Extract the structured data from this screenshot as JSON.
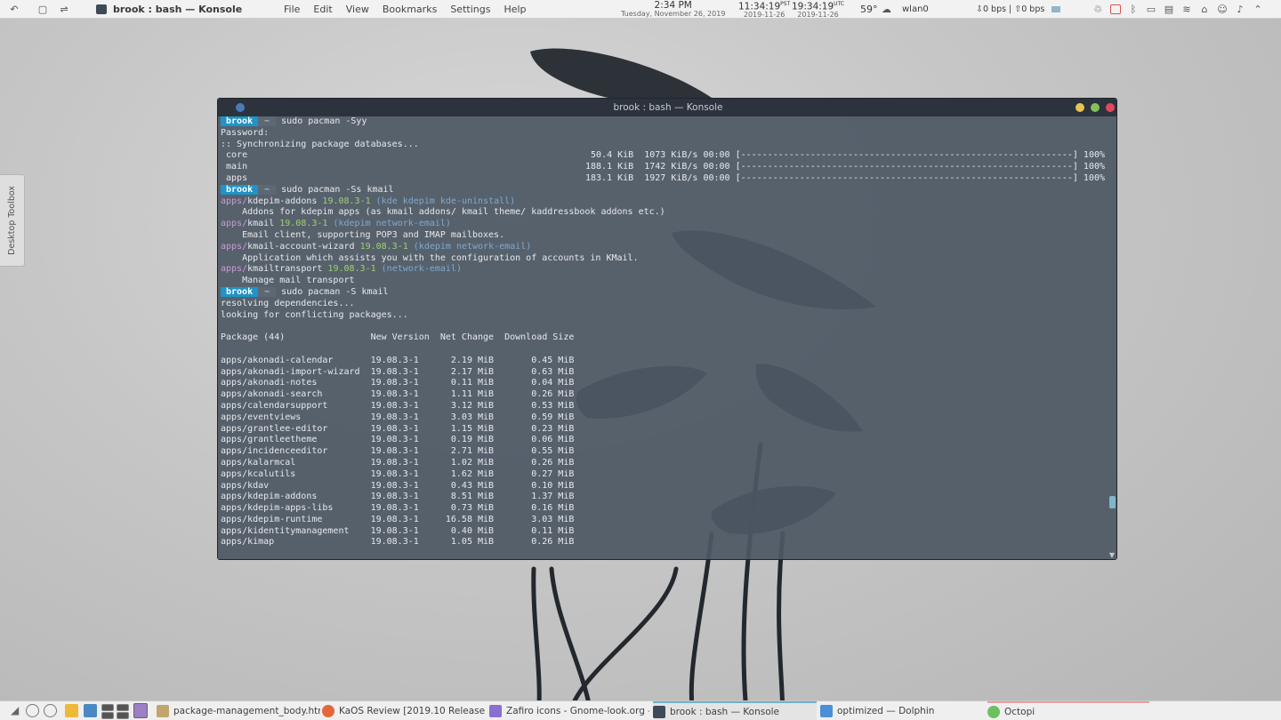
{
  "top_panel": {
    "window_title": "brook : bash — Konsole",
    "menu": [
      "File",
      "Edit",
      "View",
      "Bookmarks",
      "Settings",
      "Help"
    ],
    "clock_local": {
      "time": "2:34 PM",
      "date": "Tuesday, November 26, 2019"
    },
    "clock_pst": {
      "time": "11:34:19",
      "zone": "PST",
      "date": "2019-11-26"
    },
    "clock_utc": {
      "time": "19:34:19",
      "zone": "UTC",
      "date": "2019-11-26"
    },
    "weather": "59°",
    "network_iface": "wlan0",
    "net_down": "0 bps",
    "net_up": "0 bps",
    "separator": "|"
  },
  "toolbox": {
    "label": "Desktop Toolbox"
  },
  "konsole": {
    "title": "brook : bash — Konsole",
    "prompt_user": "brook",
    "prompt_dir": "~",
    "lines": {
      "cmd1": "sudo pacman -Syy",
      "password": "Password:",
      "sync": ":: Synchronizing package databases...",
      "core_name": " core",
      "core_stats": "50.4 KiB  1073 KiB/s 00:00 [--------------------------------------------------------------] 100%",
      "main_name": " main",
      "main_stats": "188.1 KiB  1742 KiB/s 00:00 [--------------------------------------------------------------] 100%",
      "apps_name": " apps",
      "apps_stats": "183.1 KiB  1927 KiB/s 00:00 [--------------------------------------------------------------] 100%",
      "cmd2": "sudo pacman -Ss kmail",
      "cmd3": "sudo pacman -S kmail",
      "resolving": "resolving dependencies...",
      "conflicts": "looking for conflicting packages...",
      "table_header": "Package (44)                New Version  Net Change  Download Size"
    },
    "search_results": [
      {
        "repo": "apps/",
        "name": "kdepim-addons",
        "ver": "19.08.3-1",
        "groups": "(kde kdepim kde-uninstall)",
        "desc": "    Addons for kdepim apps (as kmail addons/ kmail theme/ kaddressbook addons etc.)"
      },
      {
        "repo": "apps/",
        "name": "kmail",
        "ver": "19.08.3-1",
        "groups": "(kdepim network-email)",
        "desc": "    Email client, supporting POP3 and IMAP mailboxes."
      },
      {
        "repo": "apps/",
        "name": "kmail-account-wizard",
        "ver": "19.08.3-1",
        "groups": "(kdepim network-email)",
        "desc": "    Application which assists you with the configuration of accounts in KMail."
      },
      {
        "repo": "apps/",
        "name": "kmailtransport",
        "ver": "19.08.3-1",
        "groups": "(network-email)",
        "desc": "    Manage mail transport"
      }
    ],
    "packages": [
      "apps/akonadi-calendar       19.08.3-1      2.19 MiB       0.45 MiB",
      "apps/akonadi-import-wizard  19.08.3-1      2.17 MiB       0.63 MiB",
      "apps/akonadi-notes          19.08.3-1      0.11 MiB       0.04 MiB",
      "apps/akonadi-search         19.08.3-1      1.11 MiB       0.26 MiB",
      "apps/calendarsupport        19.08.3-1      3.12 MiB       0.53 MiB",
      "apps/eventviews             19.08.3-1      3.03 MiB       0.59 MiB",
      "apps/grantlee-editor        19.08.3-1      1.15 MiB       0.23 MiB",
      "apps/grantleetheme          19.08.3-1      0.19 MiB       0.06 MiB",
      "apps/incidenceeditor        19.08.3-1      2.71 MiB       0.55 MiB",
      "apps/kalarmcal              19.08.3-1      1.02 MiB       0.26 MiB",
      "apps/kcalutils              19.08.3-1      1.62 MiB       0.27 MiB",
      "apps/kdav                   19.08.3-1      0.43 MiB       0.10 MiB",
      "apps/kdepim-addons          19.08.3-1      8.51 MiB       1.37 MiB",
      "apps/kdepim-apps-libs       19.08.3-1      0.73 MiB       0.16 MiB",
      "apps/kdepim-runtime         19.08.3-1     16.58 MiB       3.03 MiB",
      "apps/kidentitymanagement    19.08.3-1      0.40 MiB       0.11 MiB",
      "apps/kimap                  19.08.3-1      1.05 MiB       0.26 MiB"
    ]
  },
  "taskbar": {
    "tasks": [
      {
        "label": "package-management_body.html...",
        "icon": "text-editor-icon"
      },
      {
        "label": "KaOS Review [2019.10 Release] Re...",
        "icon": "browser-icon"
      },
      {
        "label": "Zafiro icons - Gnome-look.org - Fi...",
        "icon": "browser-icon"
      },
      {
        "label": "brook : bash — Konsole",
        "icon": "terminal-icon"
      },
      {
        "label": "optimized — Dolphin",
        "icon": "folder-icon"
      },
      {
        "label": "Octopi",
        "icon": "octopi-icon"
      }
    ]
  },
  "colors": {
    "prompt_user": "#1e94c8",
    "repo": "#c99bd7",
    "version": "#9ed073",
    "groups": "#7fa9cf",
    "terminal_bg": "#4e5864"
  }
}
